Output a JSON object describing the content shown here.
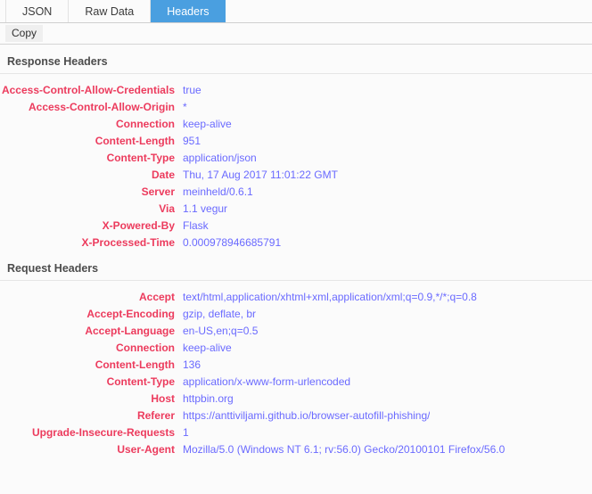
{
  "tabs": [
    {
      "label": "JSON",
      "active": false
    },
    {
      "label": "Raw Data",
      "active": false
    },
    {
      "label": "Headers",
      "active": true
    }
  ],
  "toolbar": {
    "copy_label": "Copy"
  },
  "colors": {
    "accent_tab": "#4a9fe0",
    "header_name": "#ec3b5d",
    "header_value": "#6a6aff",
    "section_title": "#4c4c4c",
    "background": "#fbfbfb"
  },
  "sections": [
    {
      "title": "Response Headers",
      "headers": [
        {
          "name": "Access-Control-Allow-Credentials",
          "value": "true"
        },
        {
          "name": "Access-Control-Allow-Origin",
          "value": "*"
        },
        {
          "name": "Connection",
          "value": "keep-alive"
        },
        {
          "name": "Content-Length",
          "value": "951"
        },
        {
          "name": "Content-Type",
          "value": "application/json"
        },
        {
          "name": "Date",
          "value": "Thu, 17 Aug 2017 11:01:22 GMT"
        },
        {
          "name": "Server",
          "value": "meinheld/0.6.1"
        },
        {
          "name": "Via",
          "value": "1.1 vegur"
        },
        {
          "name": "X-Powered-By",
          "value": "Flask"
        },
        {
          "name": "X-Processed-Time",
          "value": "0.000978946685791"
        }
      ]
    },
    {
      "title": "Request Headers",
      "headers": [
        {
          "name": "Accept",
          "value": "text/html,application/xhtml+xml,application/xml;q=0.9,*/*;q=0.8"
        },
        {
          "name": "Accept-Encoding",
          "value": "gzip, deflate, br"
        },
        {
          "name": "Accept-Language",
          "value": "en-US,en;q=0.5"
        },
        {
          "name": "Connection",
          "value": "keep-alive"
        },
        {
          "name": "Content-Length",
          "value": "136"
        },
        {
          "name": "Content-Type",
          "value": "application/x-www-form-urlencoded"
        },
        {
          "name": "Host",
          "value": "httpbin.org"
        },
        {
          "name": "Referer",
          "value": "https://anttiviljami.github.io/browser-autofill-phishing/"
        },
        {
          "name": "Upgrade-Insecure-Requests",
          "value": "1"
        },
        {
          "name": "User-Agent",
          "value": "Mozilla/5.0 (Windows NT 6.1; rv:56.0) Gecko/20100101 Firefox/56.0"
        }
      ]
    }
  ]
}
